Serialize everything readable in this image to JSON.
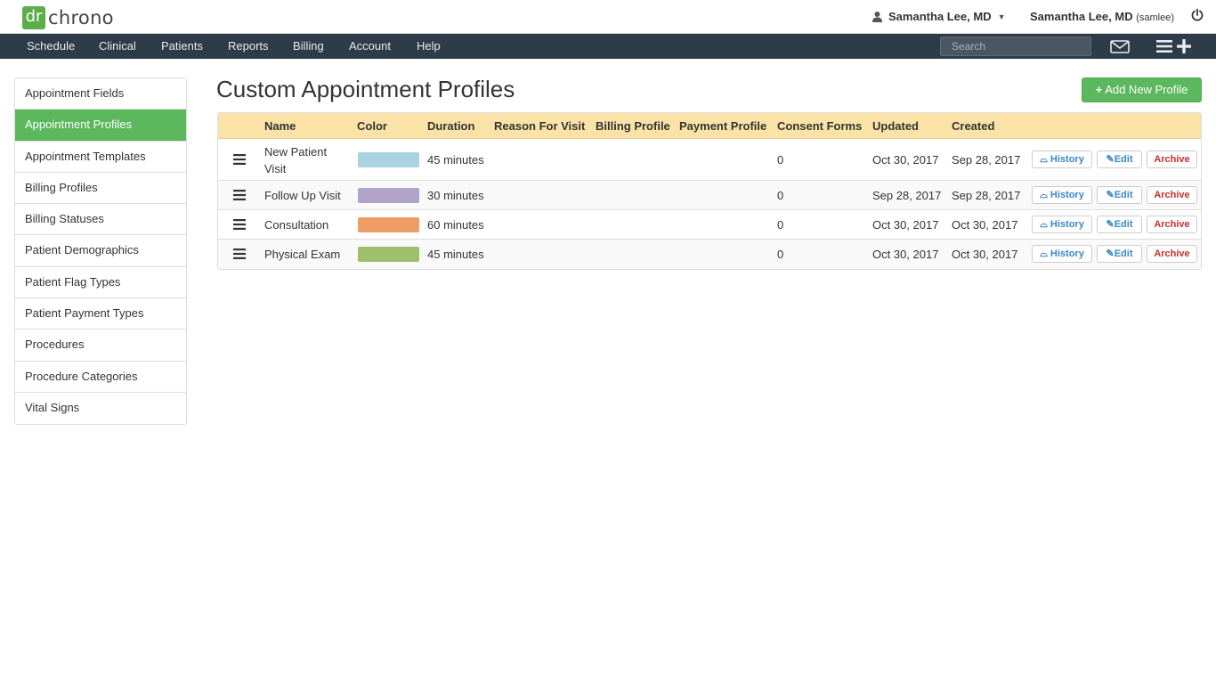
{
  "header": {
    "logo_mark": "dr",
    "logo_text": "chrono",
    "user_menu": "Samantha Lee, MD",
    "user_name": "Samantha Lee, MD",
    "username": "(samlee)"
  },
  "nav": {
    "items": [
      "Schedule",
      "Clinical",
      "Patients",
      "Reports",
      "Billing",
      "Account",
      "Help"
    ],
    "search_placeholder": "Search"
  },
  "sidebar": {
    "items": [
      {
        "label": "Appointment Fields",
        "active": false
      },
      {
        "label": "Appointment Profiles",
        "active": true
      },
      {
        "label": "Appointment Templates",
        "active": false
      },
      {
        "label": "Billing Profiles",
        "active": false
      },
      {
        "label": "Billing Statuses",
        "active": false
      },
      {
        "label": "Patient Demographics",
        "active": false
      },
      {
        "label": "Patient Flag Types",
        "active": false
      },
      {
        "label": "Patient Payment Types",
        "active": false
      },
      {
        "label": "Procedures",
        "active": false
      },
      {
        "label": "Procedure Categories",
        "active": false
      },
      {
        "label": "Vital Signs",
        "active": false
      }
    ]
  },
  "main": {
    "title": "Custom Appointment Profiles",
    "add_button": "Add New Profile",
    "columns": [
      "Name",
      "Color",
      "Duration",
      "Reason For Visit",
      "Billing Profile",
      "Payment Profile",
      "Consent Forms",
      "Updated",
      "Created"
    ],
    "rows": [
      {
        "name": "New Patient Visit",
        "color": "#a9d3e0",
        "duration": "45 minutes",
        "reason": "",
        "billing_profile": "",
        "payment_profile": "",
        "consent_forms": "0",
        "updated": "Oct 30, 2017",
        "created": "Sep 28, 2017"
      },
      {
        "name": "Follow Up Visit",
        "color": "#b1a3c9",
        "duration": "30 minutes",
        "reason": "",
        "billing_profile": "",
        "payment_profile": "",
        "consent_forms": "0",
        "updated": "Sep 28, 2017",
        "created": "Sep 28, 2017"
      },
      {
        "name": "Consultation",
        "color": "#ee9e64",
        "duration": "60 minutes",
        "reason": "",
        "billing_profile": "",
        "payment_profile": "",
        "consent_forms": "0",
        "updated": "Oct 30, 2017",
        "created": "Oct 30, 2017"
      },
      {
        "name": "Physical Exam",
        "color": "#9bbf6a",
        "duration": "45 minutes",
        "reason": "",
        "billing_profile": "",
        "payment_profile": "",
        "consent_forms": "0",
        "updated": "Oct 30, 2017",
        "created": "Oct 30, 2017"
      }
    ],
    "row_actions": {
      "history": "History",
      "edit": "Edit",
      "archive": "Archive"
    }
  },
  "colors": {
    "brand_green": "#5cb85c",
    "nav_bg": "#2e3b48",
    "table_header_bg": "#fbe3a7",
    "link_blue": "#3a87c8",
    "archive_red": "#c9302c"
  },
  "icons": [
    "person-icon",
    "caret-down-icon",
    "power-icon",
    "mail-icon",
    "menu-icon",
    "plus-icon",
    "drag-handle-icon",
    "history-icon",
    "pencil-icon"
  ]
}
